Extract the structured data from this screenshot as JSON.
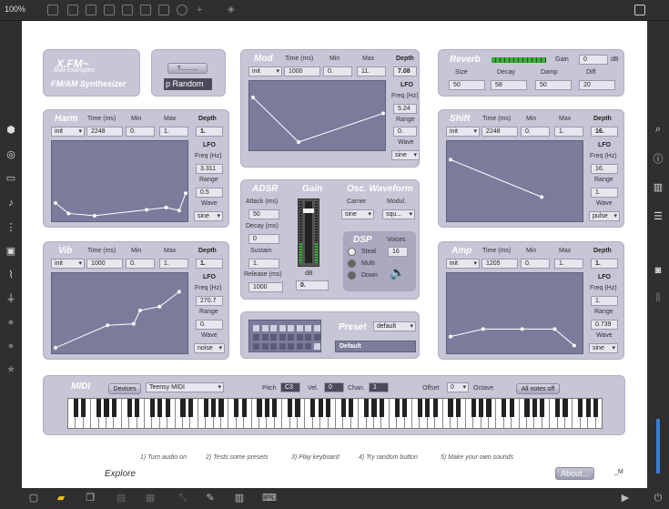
{
  "toolbar": {
    "zoom": "100%"
  },
  "title_panel": {
    "logo": "X.FM~",
    "subtitle": "Max examples",
    "name": "FM/AM Synthesizer"
  },
  "random_panel": {
    "button": "?..........",
    "random_label": "p Random"
  },
  "columns": {
    "time": "Time (ms)",
    "min": "Min",
    "max": "Max",
    "depth": "Depth",
    "lfo": "LFO",
    "freq": "Freq (Hz)",
    "range": "Range",
    "wave": "Wave"
  },
  "mod": {
    "title": "Mod",
    "preset": "init",
    "time": "1000",
    "min": "0.",
    "max": "11.",
    "depth": "7.08",
    "freq": "5.24",
    "range": "0.",
    "wave": "sine"
  },
  "harm": {
    "title": "Harm",
    "preset": "init",
    "time": "2248",
    "min": "0.",
    "max": "1.",
    "depth": "1.",
    "freq": "3.311",
    "range": "0.5",
    "wave": "sine"
  },
  "vib": {
    "title": "Vib",
    "preset": "init",
    "time": "1000",
    "min": "0.",
    "max": "1.",
    "depth": "1.",
    "freq": "270.7",
    "range": "0.",
    "wave": "noise"
  },
  "shift": {
    "title": "Shift",
    "preset": "init",
    "time": "2248",
    "min": "0.",
    "max": "1.",
    "depth": "16.",
    "freq": "16.",
    "range": "1.",
    "wave": "pulse"
  },
  "amp": {
    "title": "Amp",
    "preset": "init",
    "time": "1205",
    "min": "0.",
    "max": "1.",
    "depth": "1.",
    "freq": "1.",
    "range": "0.739",
    "wave": "sine"
  },
  "reverb": {
    "title": "Reverb",
    "gain_label": "Gain",
    "gain": "0",
    "db": "dB",
    "size_label": "Size",
    "size": "50",
    "decay_label": "Decay",
    "decay": "58",
    "damp_label": "Damp",
    "damp": "50",
    "diff_label": "Diff",
    "diff": "20"
  },
  "adsr": {
    "title": "ADSR",
    "attack_label": "Attack (ms)",
    "attack": "50",
    "decay_label": "Decay (ms)",
    "decay": "0",
    "sustain_label": "Sustain",
    "sustain": "1.",
    "release_label": "Release (ms)",
    "release": "1000"
  },
  "gain": {
    "title": "Gain",
    "db_label": "dB",
    "db": "0."
  },
  "osc": {
    "title": "Osc. Waveform",
    "carrier_label": "Carrier",
    "carrier": "sine",
    "modul_label": "Modul.",
    "modul": "squ..."
  },
  "dsp": {
    "title": "DSP",
    "voices_label": "Voices",
    "voices": "16",
    "options": [
      "Steal",
      "Multi",
      "Down"
    ]
  },
  "preset": {
    "title": "Preset",
    "menu": "default",
    "name": "Default"
  },
  "midi": {
    "title": "MIDI",
    "devices_label": "Devices",
    "device": "Teensy MIDI",
    "pitch_label": "Pitch",
    "pitch": "C3",
    "vel_label": "Vel.",
    "vel": "0",
    "chan_label": "Chan.",
    "chan": "1",
    "offset_label": "Offset",
    "offset": "0",
    "octave_label": "Octave",
    "all_notes_off": "All notes off"
  },
  "instructions": [
    "1) Turn audio on",
    "2) Tests some presets",
    "3) Play keyboard",
    "4) Try random button",
    "5) Make your own sounds"
  ],
  "footer": {
    "explore": "Explore",
    "about": "About...",
    "sig": "_M"
  },
  "chart_data": [
    {
      "type": "line",
      "title": "Mod",
      "x": [
        0,
        0.35,
        1
      ],
      "y": [
        0.8,
        0.1,
        0.55
      ]
    },
    {
      "type": "line",
      "title": "Harm",
      "x": [
        0,
        0.1,
        0.3,
        0.7,
        0.85,
        0.95,
        1
      ],
      "y": [
        0.22,
        0.08,
        0.05,
        0.13,
        0.16,
        0.12,
        0.35
      ]
    },
    {
      "type": "line",
      "title": "Vib",
      "x": [
        0,
        0.4,
        0.6,
        0.65,
        0.8,
        0.95
      ],
      "y": [
        0.05,
        0.35,
        0.37,
        0.55,
        0.6,
        0.8
      ]
    },
    {
      "type": "line",
      "title": "Shift",
      "x": [
        0,
        0.7
      ],
      "y": [
        0.8,
        0.3
      ]
    },
    {
      "type": "line",
      "title": "Amp",
      "x": [
        0,
        0.25,
        0.55,
        0.8,
        0.95
      ],
      "y": [
        0.2,
        0.3,
        0.3,
        0.3,
        0.08
      ]
    }
  ]
}
